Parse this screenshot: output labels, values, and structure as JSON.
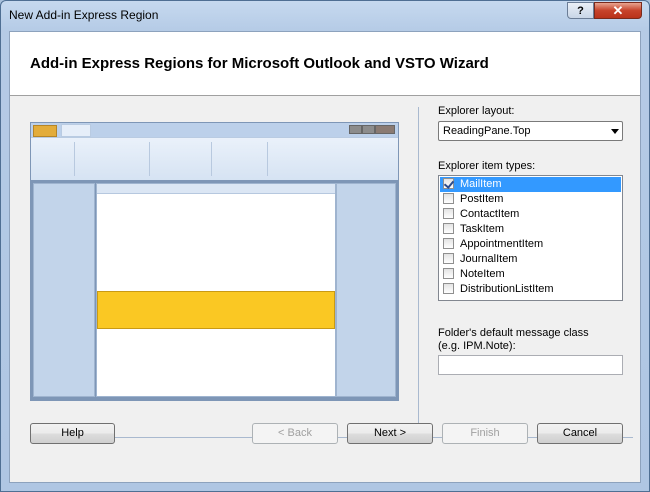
{
  "window": {
    "title": "New Add-in Express Region",
    "help_glyph": "?",
    "close_glyph": "✕"
  },
  "header": {
    "title": "Add-in Express Regions for Microsoft Outlook and VSTO Wizard"
  },
  "explorer_layout": {
    "label": "Explorer layout:",
    "value": "ReadingPane.Top"
  },
  "item_types": {
    "label": "Explorer item types:",
    "items": [
      {
        "label": "MailItem",
        "checked": true,
        "selected": true
      },
      {
        "label": "PostItem",
        "checked": false
      },
      {
        "label": "ContactItem",
        "checked": false
      },
      {
        "label": "TaskItem",
        "checked": false
      },
      {
        "label": "AppointmentItem",
        "checked": false
      },
      {
        "label": "JournalItem",
        "checked": false
      },
      {
        "label": "NoteItem",
        "checked": false
      },
      {
        "label": "DistributionListItem",
        "checked": false
      }
    ]
  },
  "message_class": {
    "label_line1": "Folder's default message class",
    "label_line2": "(e.g. IPM.Note):",
    "value": ""
  },
  "buttons": {
    "help": "Help",
    "back": "< Back",
    "next": "Next >",
    "finish": "Finish",
    "cancel": "Cancel"
  },
  "colors": {
    "region_highlight": "#fac823",
    "selection": "#3399ff"
  }
}
